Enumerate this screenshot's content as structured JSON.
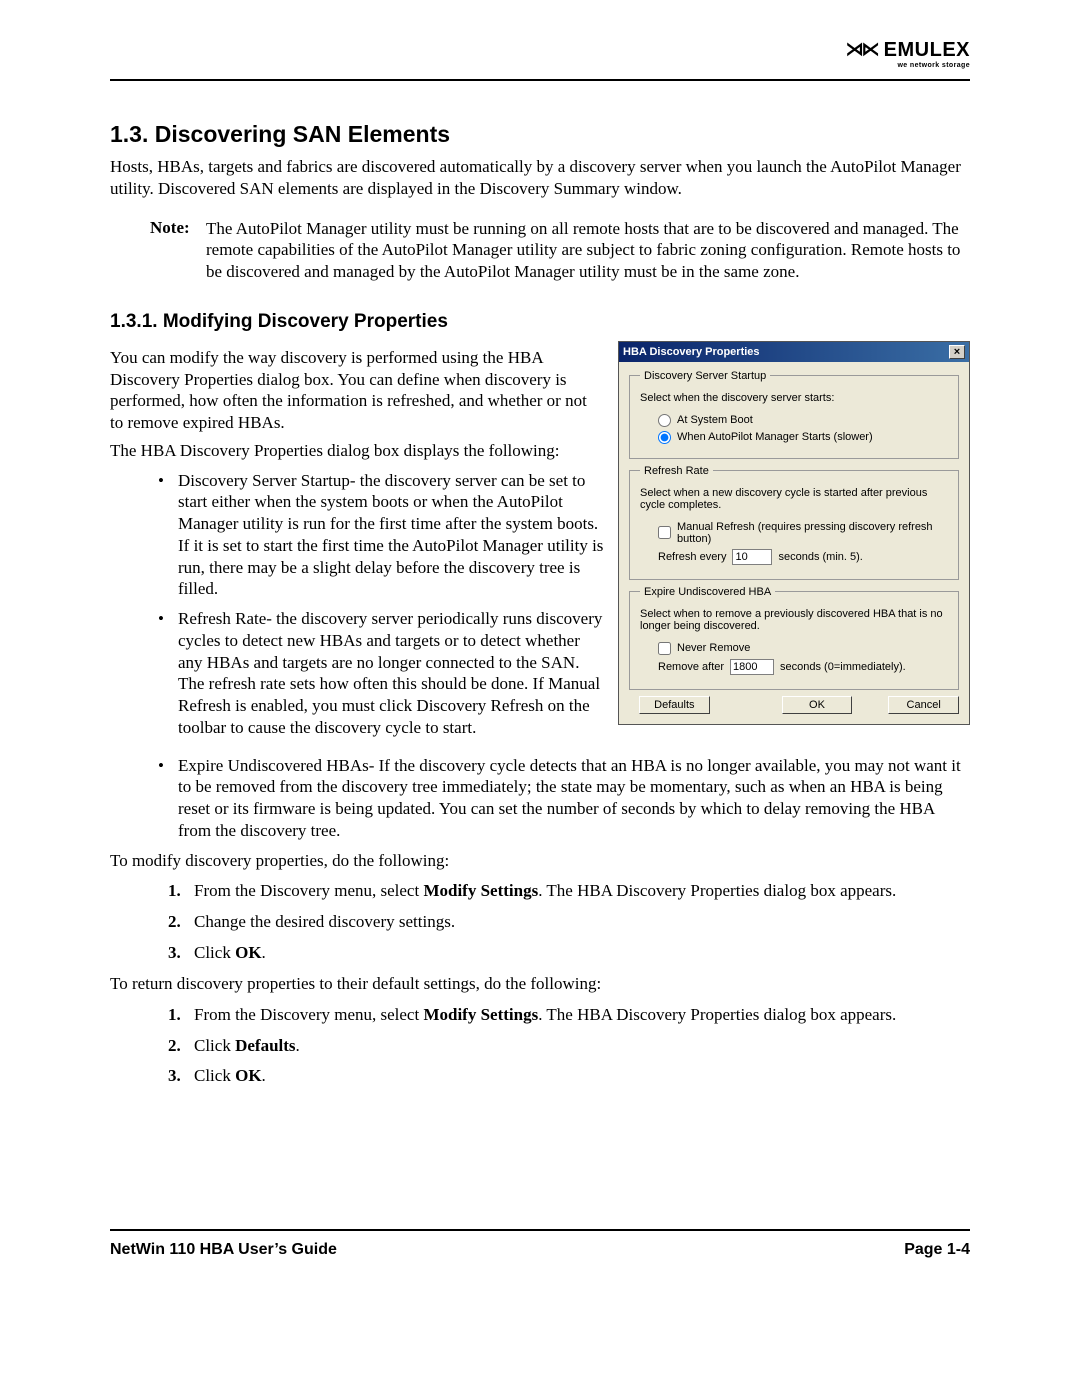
{
  "logo": {
    "brand": "EMULEX",
    "tag": "we network storage",
    "mark": "⋊⋉"
  },
  "section": {
    "number_title": "1.3. Discovering SAN Elements",
    "intro": "Hosts, HBAs, targets and fabrics are discovered automatically by a discovery server when you launch the AutoPilot Manager utility. Discovered SAN elements are displayed in the Discovery Summary window.",
    "note_label": "Note:",
    "note_body": "The AutoPilot Manager utility must be running on all remote hosts that are to be discovered and managed. The remote capabilities of the AutoPilot Manager utility are subject to fabric zoning configuration. Remote hosts to be discovered and managed by the AutoPilot Manager utility must be in the same zone."
  },
  "subsection": {
    "number_title": "1.3.1. Modifying Discovery Properties",
    "p1": "You can modify the way discovery is performed using the HBA Discovery Properties dialog box. You can define when discovery is performed, how often the information is refreshed, and whether or not to remove expired HBAs.",
    "p2": "The HBA Discovery Properties dialog box displays the following:",
    "bullets": [
      "Discovery Server Startup-  the discovery server can be set to start either when the system boots or when the AutoPilot Manager utility is run for the first time after the system boots. If it is set to start the first time the AutoPilot Manager utility is run, there may be a slight delay before the discovery tree is filled.",
      "Refresh Rate- the discovery server periodically runs discovery cycles to detect new HBAs and targets or to detect whether any HBAs and targets are no longer connected to the SAN. The refresh rate sets how often this should be done. If Manual Refresh is enabled, you must click Discovery Refresh on the toolbar to cause the discovery cycle to start."
    ],
    "bullet_after": "Expire Undiscovered HBAs- If the discovery cycle detects that an HBA is no longer available, you may not want it to be removed from the discovery tree immediately; the state may be momentary, such as when an HBA is being reset or its firmware is being updated. You can set the number of seconds by which to delay removing the HBA from the discovery tree.",
    "procA_intro": "To modify discovery properties, do the following:",
    "procA": {
      "s1a": "From the Discovery menu, select ",
      "s1b": "Modify Settings",
      "s1c": ". The HBA Discovery Properties dialog box appears.",
      "s2": "Change the desired discovery settings.",
      "s3a": "Click ",
      "s3b": "OK",
      "s3c": "."
    },
    "procB_intro": "To return discovery properties to their default settings, do the following:",
    "procB": {
      "s1a": "From the Discovery menu, select ",
      "s1b": "Modify Settings",
      "s1c": ". The HBA Discovery Properties dialog box appears.",
      "s2a": "Click ",
      "s2b": "Defaults",
      "s2c": ".",
      "s3a": "Click ",
      "s3b": "OK",
      "s3c": "."
    }
  },
  "dialog": {
    "title": "HBA Discovery Properties",
    "close": "×",
    "g1": {
      "legend": "Discovery Server Startup",
      "text": "Select when the discovery server starts:",
      "r1": "At System Boot",
      "r2": "When AutoPilot Manager Starts (slower)"
    },
    "g2": {
      "legend": "Refresh Rate",
      "text": "Select when a new discovery cycle is started after previous cycle completes.",
      "chk": "Manual Refresh (requires pressing discovery refresh button)",
      "pre": "Refresh every",
      "val": "10",
      "post": "seconds (min. 5)."
    },
    "g3": {
      "legend": "Expire Undiscovered HBA",
      "text": "Select when to remove a previously discovered HBA that is no longer being discovered.",
      "chk": "Never Remove",
      "pre": "Remove after",
      "val": "1800",
      "post": "seconds (0=immediately)."
    },
    "buttons": {
      "defaults": "Defaults",
      "ok": "OK",
      "cancel": "Cancel"
    }
  },
  "footer": {
    "left": "NetWin 110 HBA User’s Guide",
    "right": "Page 1-4"
  }
}
